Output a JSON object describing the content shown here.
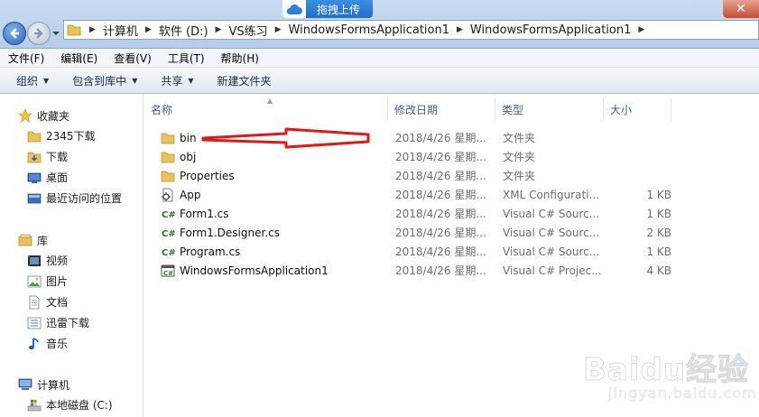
{
  "toolbar_top": {
    "drag_upload_label": "拖拽上传",
    "close_glyph": "✕"
  },
  "address": {
    "crumbs": [
      "计算机",
      "软件 (D:)",
      "VS练习",
      "WindowsFormsApplication1",
      "WindowsFormsApplication1"
    ]
  },
  "menu": {
    "items": [
      "文件(F)",
      "编辑(E)",
      "查看(V)",
      "工具(T)",
      "帮助(H)"
    ]
  },
  "toolbar": {
    "organize": "组织",
    "include_in_library": "包含到库中",
    "share": "共享",
    "new_folder": "新建文件夹"
  },
  "nav": {
    "favorites": {
      "label": "收藏夹",
      "items": [
        "2345下载",
        "下载",
        "桌面",
        "最近访问的位置"
      ]
    },
    "libraries": {
      "label": "库",
      "items": [
        "视频",
        "图片",
        "文档",
        "迅雷下载",
        "音乐"
      ]
    },
    "computer": {
      "label": "计算机",
      "items": [
        "本地磁盘 (C:)"
      ]
    }
  },
  "columns": {
    "name": "名称",
    "date": "修改日期",
    "type": "类型",
    "size": "大小"
  },
  "files": [
    {
      "name": "bin",
      "date": "2018/4/26 星期...",
      "type": "文件夹",
      "size": "",
      "icon": "folder-icon"
    },
    {
      "name": "obj",
      "date": "2018/4/26 星期...",
      "type": "文件夹",
      "size": "",
      "icon": "folder-icon"
    },
    {
      "name": "Properties",
      "date": "2018/4/26 星期...",
      "type": "文件夹",
      "size": "",
      "icon": "folder-icon"
    },
    {
      "name": "App",
      "date": "2018/4/26 星期...",
      "type": "XML Configurati...",
      "size": "1 KB",
      "icon": "config-file-icon"
    },
    {
      "name": "Form1.cs",
      "date": "2018/4/26 星期...",
      "type": "Visual C# Sourc...",
      "size": "1 KB",
      "icon": "csharp-file-icon"
    },
    {
      "name": "Form1.Designer.cs",
      "date": "2018/4/26 星期...",
      "type": "Visual C# Sourc...",
      "size": "2 KB",
      "icon": "csharp-file-icon"
    },
    {
      "name": "Program.cs",
      "date": "2018/4/26 星期...",
      "type": "Visual C# Sourc...",
      "size": "1 KB",
      "icon": "csharp-file-icon"
    },
    {
      "name": "WindowsFormsApplication1",
      "date": "2018/4/26 星期...",
      "type": "Visual C# Projec...",
      "size": "4 KB",
      "icon": "csharp-project-icon"
    }
  ],
  "watermark": {
    "main": "Baidu经验",
    "sub": "jingyan.baidu.com"
  },
  "colors": {
    "annotation_arrow": "#e01818",
    "folder": "#e8c25a",
    "accent": "#1f6fc7"
  }
}
